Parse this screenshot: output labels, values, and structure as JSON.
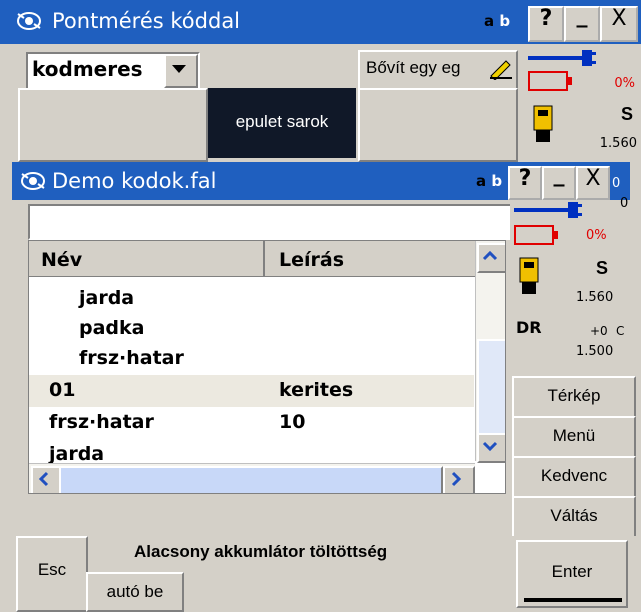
{
  "back_window": {
    "title": "Pontmérés kóddal",
    "ab_a": "a",
    "ab_b": "b",
    "help": "?",
    "minimize": "_",
    "close": "X",
    "code_select_value": "kodmeres",
    "expand_button": "Bővít egy eg",
    "code_button_label": "epulet sarok",
    "status": {
      "battery_pct": "0%",
      "mode": "S",
      "height": "1.560"
    }
  },
  "front_window": {
    "title": "Demo kodok.fal",
    "ab_a": "a",
    "ab_b": "b",
    "help": "?",
    "minimize": "_",
    "close": "X",
    "search_value": "",
    "columns": {
      "name": "Név",
      "description": "Leírás"
    },
    "rows": [
      {
        "name": "jarda",
        "desc": "",
        "indent": true
      },
      {
        "name": "padka",
        "desc": "",
        "indent": true
      },
      {
        "name": "frsz·hatar",
        "desc": "",
        "indent": true
      },
      {
        "name": "01",
        "desc": "kerites",
        "indent": false,
        "selected": true
      },
      {
        "name": "frsz·hatar",
        "desc": "10",
        "indent": false
      },
      {
        "name": "jarda",
        "desc": "",
        "indent": false
      }
    ],
    "status": {
      "battery_pct": "0%",
      "mode": "S",
      "height": "1.560",
      "dr_label": "DR",
      "dr_value": "+0",
      "dr_height": "1.500"
    },
    "side_buttons": {
      "map": "Térkép",
      "menu": "Menü",
      "favorite": "Kedvenc",
      "switch": "Váltás"
    }
  },
  "bottom_bar": {
    "esc": "Esc",
    "warning": "Alacsony akkumlátor töltöttség",
    "auto": "autó be",
    "enter": "Enter"
  },
  "edge_fragments": {
    "f1": "0",
    "f2": "0",
    "f3": "C"
  },
  "colors": {
    "title_blue": "#1f5fbf",
    "navy_button": "#101828",
    "battery_red": "#e00000",
    "antenna_blue": "#0030c0",
    "selected_row": "#ece9e0"
  }
}
